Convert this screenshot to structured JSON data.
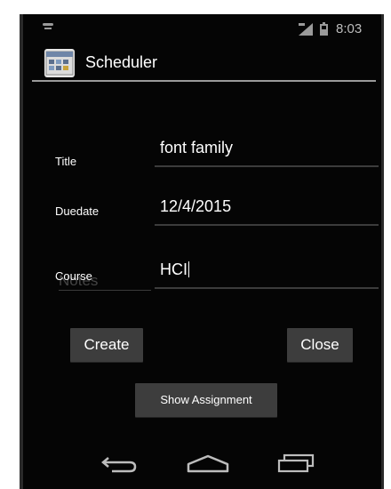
{
  "status_bar": {
    "time": "8:03"
  },
  "action_bar": {
    "title": "Scheduler",
    "app_icon": "calendar-app-icon"
  },
  "form": {
    "title_label": "Title",
    "title_value": "font family",
    "duedate_label": "Duedate",
    "duedate_value": "12/4/2015",
    "course_label": "Course",
    "course_value": "HCI",
    "notes_hint": "Notes"
  },
  "buttons": {
    "create": "Create",
    "close": "Close",
    "show_assignment": "Show Assignment"
  },
  "nav_bar": {
    "back": "back-icon",
    "home": "home-icon",
    "recents": "recents-icon"
  }
}
